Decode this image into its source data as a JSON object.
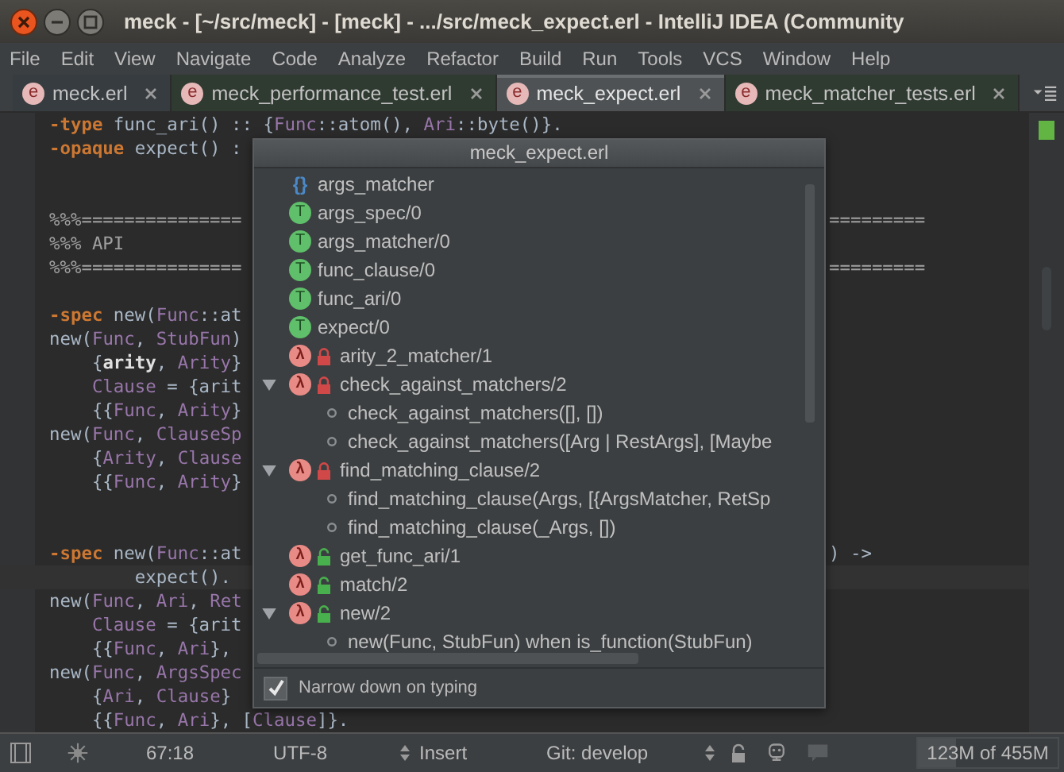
{
  "window": {
    "title": "meck - [~/src/meck] - [meck] - .../src/meck_expect.erl - IntelliJ IDEA (Community"
  },
  "menu": [
    "File",
    "Edit",
    "View",
    "Navigate",
    "Code",
    "Analyze",
    "Refactor",
    "Build",
    "Run",
    "Tools",
    "VCS",
    "Window",
    "Help"
  ],
  "tabs": [
    {
      "badge": "e",
      "label": "meck.erl",
      "color": "#373c40",
      "selected": false
    },
    {
      "badge": "e",
      "label": "meck_performance_test.erl",
      "color": "#2f3a31",
      "selected": false
    },
    {
      "badge": "e",
      "label": "meck_expect.erl",
      "color": "#4e5254",
      "selected": true
    },
    {
      "badge": "e",
      "label": "meck_matcher_tests.erl",
      "color": "#2f3a31",
      "selected": false
    }
  ],
  "editor": {
    "lines": [
      {
        "kind": "code",
        "left": [
          {
            "text": "-type",
            "kind": "keyword"
          },
          {
            "text": " func_ari() :: {",
            "kind": "plain"
          },
          {
            "text": "Func",
            "kind": "variable"
          },
          {
            "text": "::atom(), ",
            "kind": "plain"
          },
          {
            "text": "Ari",
            "kind": "variable"
          },
          {
            "text": "::byte()}.",
            "kind": "plain"
          }
        ]
      },
      {
        "kind": "code",
        "left": [
          {
            "text": "-opaque",
            "kind": "keyword"
          },
          {
            "text": " expect() :",
            "kind": "plain"
          }
        ]
      },
      {
        "kind": "blank"
      },
      {
        "kind": "blank"
      },
      {
        "kind": "code",
        "left": [
          {
            "text": "%%%===============",
            "kind": "comment"
          }
        ],
        "right": [
          {
            "text": "=========",
            "kind": "comment"
          }
        ]
      },
      {
        "kind": "code",
        "left": [
          {
            "text": "%%% API",
            "kind": "comment"
          }
        ]
      },
      {
        "kind": "code",
        "left": [
          {
            "text": "%%%===============",
            "kind": "comment"
          }
        ],
        "right": [
          {
            "text": "=========",
            "kind": "comment"
          }
        ]
      },
      {
        "kind": "blank"
      },
      {
        "kind": "code",
        "left": [
          {
            "text": "-spec",
            "kind": "keyword"
          },
          {
            "text": " new(",
            "kind": "plain"
          },
          {
            "text": "Func",
            "kind": "variable"
          },
          {
            "text": "::at",
            "kind": "plain"
          }
        ]
      },
      {
        "kind": "code",
        "left": [
          {
            "text": "new(",
            "kind": "plain"
          },
          {
            "text": "Func",
            "kind": "variable"
          },
          {
            "text": ", ",
            "kind": "plain"
          },
          {
            "text": "StubFun",
            "kind": "variable"
          },
          {
            "text": ")",
            "kind": "plain"
          }
        ]
      },
      {
        "kind": "code",
        "left": [
          {
            "text": "    {",
            "kind": "plain"
          },
          {
            "text": "arity",
            "kind": "atom"
          },
          {
            "text": ", ",
            "kind": "plain"
          },
          {
            "text": "Arity",
            "kind": "variable"
          },
          {
            "text": "}",
            "kind": "plain"
          }
        ]
      },
      {
        "kind": "code",
        "left": [
          {
            "text": "    Clause",
            "kind": "variable"
          },
          {
            "text": " = {arit",
            "kind": "plain"
          }
        ]
      },
      {
        "kind": "code",
        "left": [
          {
            "text": "    {{",
            "kind": "plain"
          },
          {
            "text": "Func",
            "kind": "variable"
          },
          {
            "text": ", ",
            "kind": "plain"
          },
          {
            "text": "Arity",
            "kind": "variable"
          },
          {
            "text": "}",
            "kind": "plain"
          }
        ]
      },
      {
        "kind": "code",
        "left": [
          {
            "text": "new(",
            "kind": "plain"
          },
          {
            "text": "Func",
            "kind": "variable"
          },
          {
            "text": ", ",
            "kind": "plain"
          },
          {
            "text": "ClauseSp",
            "kind": "variable"
          }
        ]
      },
      {
        "kind": "code",
        "left": [
          {
            "text": "    {",
            "kind": "plain"
          },
          {
            "text": "Arity",
            "kind": "variable"
          },
          {
            "text": ", ",
            "kind": "plain"
          },
          {
            "text": "Clause",
            "kind": "variable"
          }
        ]
      },
      {
        "kind": "code",
        "left": [
          {
            "text": "    {{",
            "kind": "plain"
          },
          {
            "text": "Func",
            "kind": "variable"
          },
          {
            "text": ", ",
            "kind": "plain"
          },
          {
            "text": "Arity",
            "kind": "variable"
          },
          {
            "text": "}",
            "kind": "plain"
          }
        ]
      },
      {
        "kind": "blank"
      },
      {
        "kind": "blank"
      },
      {
        "kind": "code",
        "left": [
          {
            "text": "-spec",
            "kind": "keyword"
          },
          {
            "text": " new(",
            "kind": "plain"
          },
          {
            "text": "Func",
            "kind": "variable"
          },
          {
            "text": "::at",
            "kind": "plain"
          }
        ],
        "right": [
          {
            "text": ") ->",
            "kind": "plain"
          }
        ]
      },
      {
        "kind": "code",
        "current": true,
        "left": [
          {
            "text": "        expect().",
            "kind": "plain"
          }
        ]
      },
      {
        "kind": "code",
        "left": [
          {
            "text": "new(",
            "kind": "plain"
          },
          {
            "text": "Func",
            "kind": "variable"
          },
          {
            "text": ", ",
            "kind": "plain"
          },
          {
            "text": "Ari",
            "kind": "variable"
          },
          {
            "text": ", ",
            "kind": "plain"
          },
          {
            "text": "Ret",
            "kind": "variable"
          }
        ]
      },
      {
        "kind": "code",
        "left": [
          {
            "text": "    Clause",
            "kind": "variable"
          },
          {
            "text": " = {arit",
            "kind": "plain"
          }
        ]
      },
      {
        "kind": "code",
        "left": [
          {
            "text": "    {{",
            "kind": "plain"
          },
          {
            "text": "Func",
            "kind": "variable"
          },
          {
            "text": ", ",
            "kind": "plain"
          },
          {
            "text": "Ari",
            "kind": "variable"
          },
          {
            "text": "},",
            "kind": "plain"
          }
        ]
      },
      {
        "kind": "code",
        "left": [
          {
            "text": "new(",
            "kind": "plain"
          },
          {
            "text": "Func",
            "kind": "variable"
          },
          {
            "text": ", ",
            "kind": "plain"
          },
          {
            "text": "ArgsSpec",
            "kind": "variable"
          }
        ]
      },
      {
        "kind": "code",
        "left": [
          {
            "text": "    {",
            "kind": "plain"
          },
          {
            "text": "Ari",
            "kind": "variable"
          },
          {
            "text": ", ",
            "kind": "plain"
          },
          {
            "text": "Clause",
            "kind": "variable"
          },
          {
            "text": "}",
            "kind": "plain"
          }
        ]
      },
      {
        "kind": "code",
        "left": [
          {
            "text": "    {{",
            "kind": "plain"
          },
          {
            "text": "Func",
            "kind": "variable"
          },
          {
            "text": ", ",
            "kind": "plain"
          },
          {
            "text": "Ari",
            "kind": "variable"
          },
          {
            "text": "}, [",
            "kind": "plain"
          },
          {
            "text": "Clause",
            "kind": "variable"
          },
          {
            "text": "]}.",
            "kind": "plain"
          }
        ]
      }
    ]
  },
  "popup": {
    "title": "meck_expect.erl",
    "items": [
      {
        "kind": "record",
        "badge": "{}",
        "label": "args_matcher"
      },
      {
        "kind": "type",
        "badge": "T",
        "label": "args_spec/0"
      },
      {
        "kind": "type",
        "badge": "T",
        "label": "args_matcher/0"
      },
      {
        "kind": "type",
        "badge": "T",
        "label": "func_clause/0"
      },
      {
        "kind": "type",
        "badge": "T",
        "label": "func_ari/0"
      },
      {
        "kind": "type",
        "badge": "T",
        "label": "expect/0"
      },
      {
        "kind": "function",
        "badge": "λ",
        "label": "arity_2_matcher/1",
        "private": true
      },
      {
        "kind": "function",
        "badge": "λ",
        "label": "check_against_matchers/2",
        "private": true,
        "expanded": true,
        "children": [
          {
            "label": "check_against_matchers([], [])"
          },
          {
            "label": "check_against_matchers([Arg | RestArgs], [Maybe"
          }
        ]
      },
      {
        "kind": "function",
        "badge": "λ",
        "label": "find_matching_clause/2",
        "private": true,
        "expanded": true,
        "children": [
          {
            "label": "find_matching_clause(Args, [{ArgsMatcher, RetSp"
          },
          {
            "label": "find_matching_clause(_Args, [])"
          }
        ]
      },
      {
        "kind": "function",
        "badge": "λ",
        "label": "get_func_ari/1",
        "private": false
      },
      {
        "kind": "function",
        "badge": "λ",
        "label": "match/2",
        "private": false
      },
      {
        "kind": "function",
        "badge": "λ",
        "label": "new/2",
        "private": false,
        "expanded": true,
        "children": [
          {
            "label": "new(Func, StubFun) when is_function(StubFun)"
          }
        ]
      }
    ],
    "narrow_down": {
      "label": "Narrow down on typing",
      "checked": true
    }
  },
  "status_bar": {
    "position": "67:18",
    "encoding": "UTF-8",
    "mode": "Insert",
    "vcs": "Git: develop",
    "memory": {
      "text": "123M of 455M",
      "level": 0.27
    }
  }
}
